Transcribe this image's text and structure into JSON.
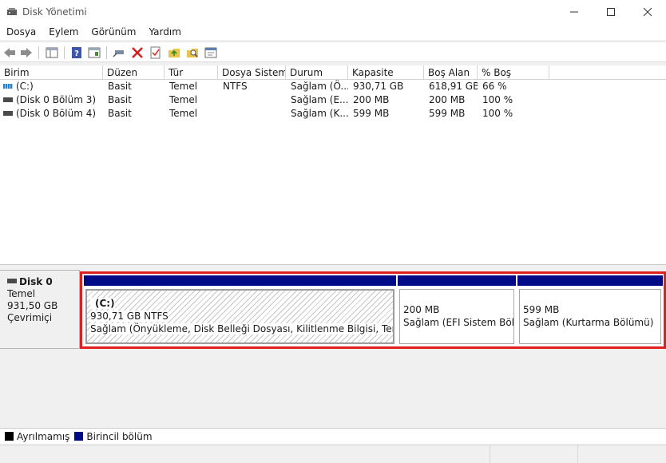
{
  "window": {
    "title": "Disk Yönetimi"
  },
  "menu": [
    "Dosya",
    "Eylem",
    "Görünüm",
    "Yardım"
  ],
  "toolbar": {
    "buttons": [
      "back-icon",
      "forward-icon",
      "properties-pane-icon",
      "help-icon",
      "console-tree-icon",
      "connect-icon",
      "delete-icon",
      "checklist-icon",
      "export-folder-icon",
      "search-folder-icon",
      "settings-window-icon"
    ]
  },
  "volume_list": {
    "columns": [
      "Birim",
      "Düzen",
      "Tür",
      "Dosya Sistemi",
      "Durum",
      "Kapasite",
      "Boş Alan",
      "% Boş"
    ],
    "rows": [
      {
        "birim": "(C:)",
        "duzen": "Basit",
        "tur": "Temel",
        "dosya_sistemi": "NTFS",
        "durum": "Sağlam (Ö...",
        "kapasite": "930,71 GB",
        "bos_alan": "618,91 GB",
        "yuzde_bos": "66 %"
      },
      {
        "birim": "(Disk 0 Bölüm 3)",
        "duzen": "Basit",
        "tur": "Temel",
        "dosya_sistemi": "",
        "durum": "Sağlam (E...",
        "kapasite": "200 MB",
        "bos_alan": "200 MB",
        "yuzde_bos": "100 %"
      },
      {
        "birim": "(Disk 0 Bölüm 4)",
        "duzen": "Basit",
        "tur": "Temel",
        "dosya_sistemi": "",
        "durum": "Sağlam (K...",
        "kapasite": "599 MB",
        "bos_alan": "599 MB",
        "yuzde_bos": "100 %"
      }
    ]
  },
  "disk": {
    "name": "Disk 0",
    "type": "Temel",
    "size": "931,50 GB",
    "status": "Çevrimiçi",
    "partitions": [
      {
        "label": "(C:)",
        "size": "930,71 GB NTFS",
        "status": "Sağlam (Önyükleme, Disk Belleği Dosyası, Kilitlenme Bilgisi, Temel Veri Bölümü)"
      },
      {
        "label": "",
        "size": "200 MB",
        "status": "Sağlam (EFI Sistem Bölümü)"
      },
      {
        "label": "",
        "size": "599 MB",
        "status": "Sağlam (Kurtarma Bölümü)"
      }
    ]
  },
  "legend": [
    {
      "label": "Ayrılmamış",
      "color": "#000000"
    },
    {
      "label": "Birincil bölüm",
      "color": "#000a86"
    }
  ],
  "colors": {
    "partition_bar": "#000a86",
    "highlight_border": "#e0201e"
  }
}
